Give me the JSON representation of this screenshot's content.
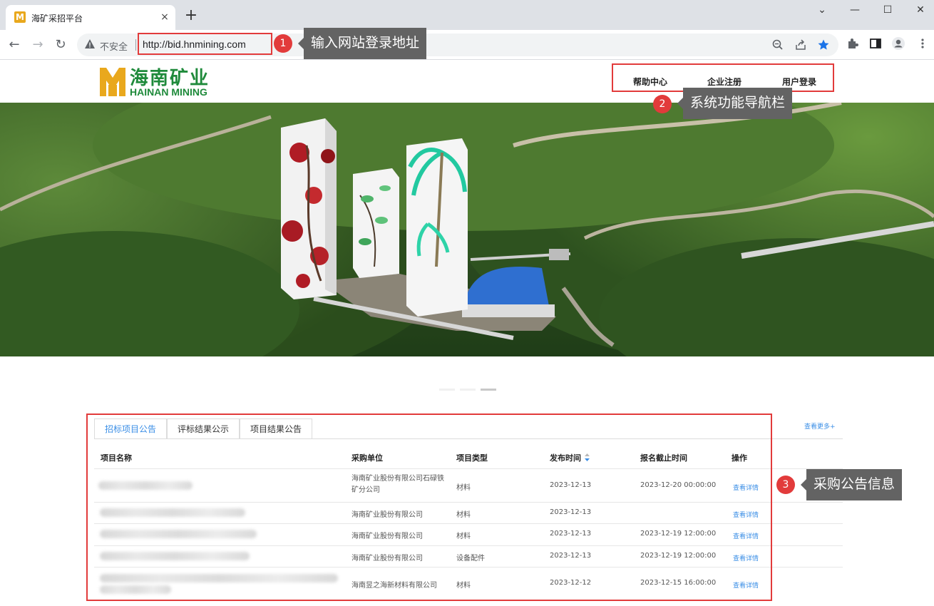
{
  "browser": {
    "tab_title": "海矿采招平台",
    "tab_close": "×",
    "new_tab": "+",
    "favicon_letter": "M",
    "window_controls": {
      "dropdown": "⌄",
      "minimize": "—",
      "maximize": "☐",
      "close": "✕"
    },
    "nav": {
      "back": "←",
      "forward": "→",
      "reload": "↻"
    },
    "insecure_label": "不安全",
    "url": "http://bid.hnmining.com",
    "omnibox_icons": [
      "zoom-icon",
      "share-icon",
      "bookmark-star-icon"
    ],
    "toolbar_icons": [
      "extensions-icon",
      "side-panel-icon",
      "profile-icon",
      "menu-icon"
    ]
  },
  "site": {
    "logo_cn": "海南矿业",
    "logo_en": "HAINAN MINING",
    "nav": [
      "帮助中心",
      "企业注册",
      "用户登录"
    ]
  },
  "announcements": {
    "tabs": [
      "招标项目公告",
      "评标结果公示",
      "项目结果公告"
    ],
    "active_tab": 0,
    "more_link": "查看更多+",
    "columns": [
      "项目名称",
      "采购单位",
      "项目类型",
      "发布时间",
      "报名截止时间",
      "操作"
    ],
    "sort_icon": "sort-icon",
    "rows": [
      {
        "unit": "海南矿业股份有限公司石碌铁矿分公司",
        "type": "材料",
        "published": "2023-12-13",
        "deadline": "2023-12-20 00:00:00",
        "action": "查看详情"
      },
      {
        "unit": "海南矿业股份有限公司",
        "type": "材料",
        "published": "2023-12-13",
        "deadline": "",
        "action": "查看详情"
      },
      {
        "unit": "海南矿业股份有限公司",
        "type": "材料",
        "published": "2023-12-13",
        "deadline": "2023-12-19 12:00:00",
        "action": "查看详情"
      },
      {
        "unit": "海南矿业股份有限公司",
        "type": "设备配件",
        "published": "2023-12-13",
        "deadline": "2023-12-19 12:00:00",
        "action": "查看详情"
      },
      {
        "unit": "海南昱之海新材料有限公司",
        "type": "材料",
        "published": "2023-12-12",
        "deadline": "2023-12-15 16:00:00",
        "action": "查看详情"
      }
    ]
  },
  "annotations": [
    {
      "number": "1",
      "text": "输入网站登录地址"
    },
    {
      "number": "2",
      "text": "系统功能导航栏"
    },
    {
      "number": "3",
      "text": "采购公告信息"
    }
  ],
  "colors": {
    "accent": "#3a8ee6",
    "annotation_red": "#e23b3b",
    "brand_green": "#1f8a3b",
    "brand_gold": "#e9a81d",
    "callout_bg": "#636363"
  }
}
